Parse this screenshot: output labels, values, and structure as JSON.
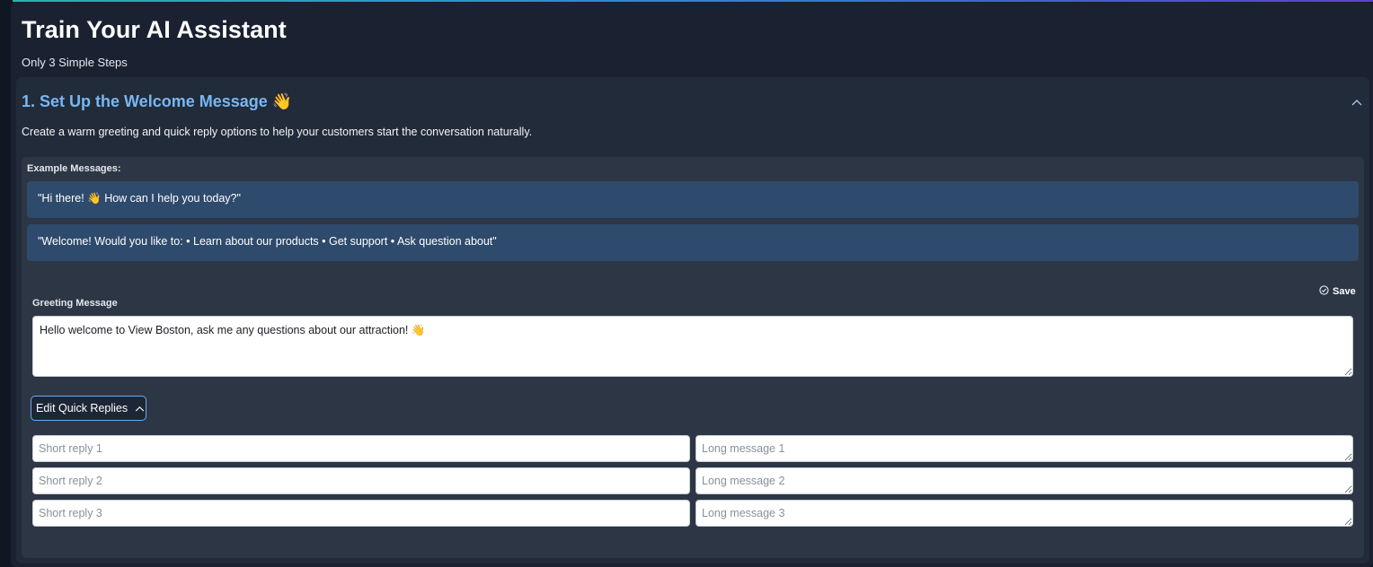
{
  "page": {
    "title": "Train Your AI Assistant",
    "subtitle": "Only 3 Simple Steps"
  },
  "section": {
    "title": "1. Set Up the Welcome Message 👋",
    "description": "Create a warm greeting and quick reply options to help your customers start the conversation naturally."
  },
  "examples": {
    "label": "Example Messages:",
    "items": [
      "\"Hi there! 👋 How can I help you today?\"",
      "\"Welcome! Would you like to: • Learn about our products • Get support • Ask question about\""
    ]
  },
  "greeting": {
    "save_label": "Save",
    "label": "Greeting Message",
    "value": "Hello welcome to View Boston, ask me any questions about our attraction! 👋"
  },
  "quick_replies": {
    "toggle_label": "Edit Quick Replies",
    "rows": [
      {
        "short_placeholder": "Short reply 1",
        "long_placeholder": "Long message 1"
      },
      {
        "short_placeholder": "Short reply 2",
        "long_placeholder": "Long message 2"
      },
      {
        "short_placeholder": "Short reply 3",
        "long_placeholder": "Long message 3"
      }
    ]
  },
  "icons": {
    "collapse": "chevron-up-icon",
    "save": "check-circle-icon",
    "toggle": "chevron-up-icon"
  },
  "colors": {
    "accent_title": "#78b7f2",
    "example_bg": "#2e4a6c",
    "button_border": "#6aa9ee"
  }
}
